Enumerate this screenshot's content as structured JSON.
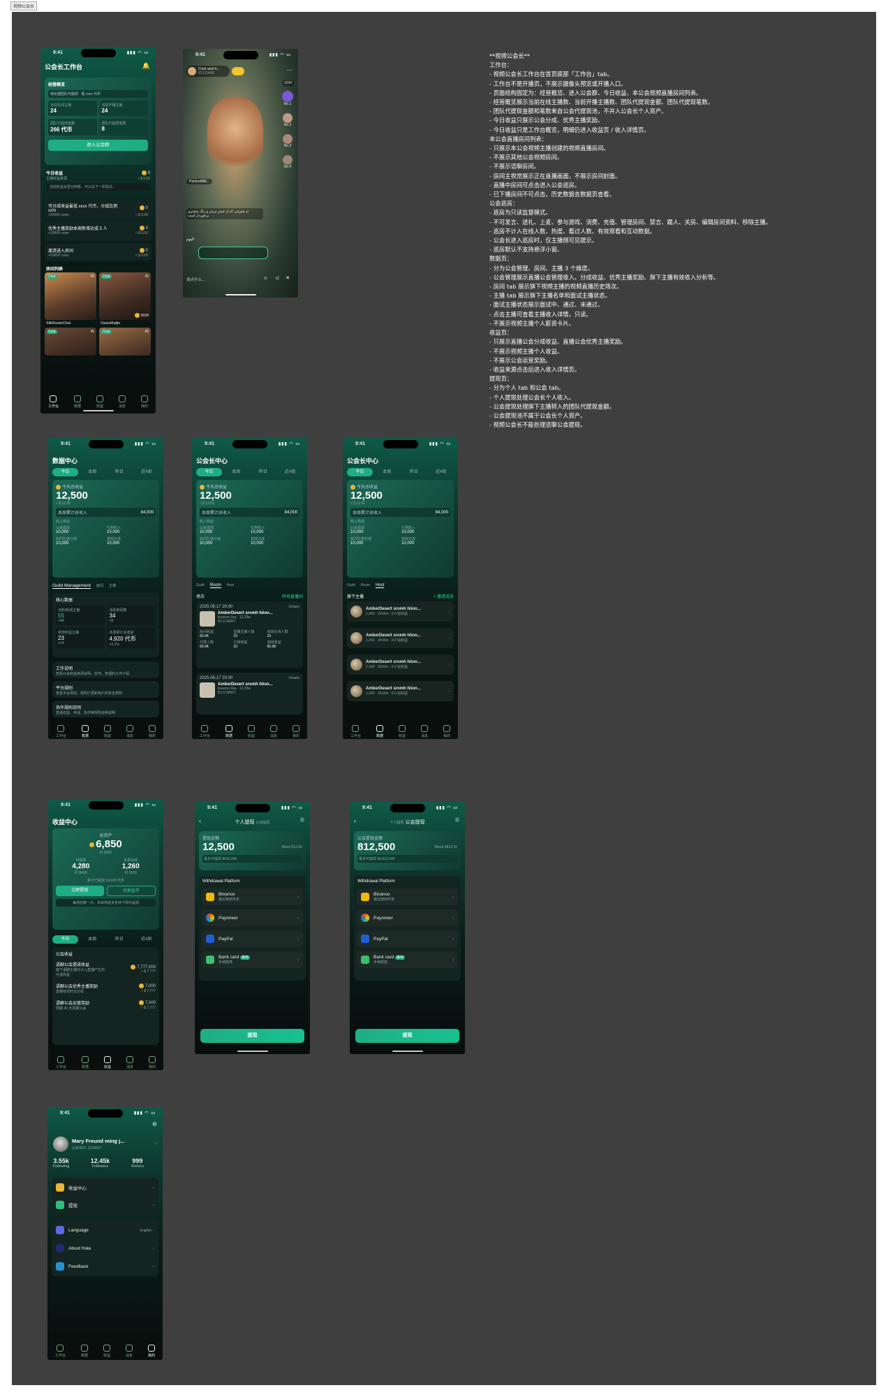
{
  "frame_tag": "视频公会长",
  "spec_text": "**视频公会长**\n工作台：\n- 视频公会长工作台在首页底部「工作台」tab。\n- 工作台不是开播页，不展示摄像头预览或开播入口。\n- 页面结构固定为：经营概览、进入公会群、今日收益、本公会视频直播房间列表。\n- 经营概览展示当前在线主播数、当前开播主播数、团队代提现金额、团队代提现笔数。\n- 团队代提现金额和笔数来自公会代提现池，不并入公会长个人资产。\n- 今日收益只展示公会分成、优秀主播奖励。\n- 今日收益只是工作台概览，明细仍进入收益页 / 收入详情页。\n本公会直播房间列表：\n- 只展示本公会视频主播创建的视频直播房间。\n- 不展示其他公会视频房间。\n- 不展示语聊房间。\n- 房间主视觉展示正在直播画面，不展示房间封面。\n- 直播中房间可点击进入公会巡房。\n- 已下播房间不可点击，历史数据去数据页查看。\n公会巡房：\n- 巡房为只读监督模式。\n- 不可发言、送礼、上麦、参与游戏、消费、充值、管理房间、禁言、踢人、关房、编辑房间资料、移除主播。\n- 巡房不计入在线人数、热度、看过人数、有效观看和互动数据。\n- 公会长进入巡房时，仅主播侧可见提示。\n- 巡房默认不支持悬浮小窗。\n数据页：\n- 分为公会管理、房间、主播 3 个维度。\n- 公会管理展示直播公会管理收入、分成收益、优秀主播奖励、旗下主播有效收入分析等。\n- 房间 tab 展示旗下视频主播的视频直播历史场次。\n- 主播 tab 展示旗下主播名单和面试主播状态。\n- 面试主播状态展示面试中、通过、未通过。\n- 点击主播可查看主播收入详情，只读。\n- 不展示视频主播个人薪资卡片。\n收益页：\n- 只展示直播公会分成收益、直播公会优秀主播奖励。\n- 不展示视频主播个人收益。\n- 不展示公会运营奖励。\n- 收益来源点击后进入收入详情页。\n提现页：\n- 分为个人 tab 和公会 tab。\n- 个人提现处理公会长个人收入。\n- 公会提现处理旗下主播转入的团队代提现金额。\n- 公会提现池不属于公会长个人资产。\n- 视频公会长不能处理语聊公会提现。",
  "status": {
    "time": "9:41",
    "signal": "▮▮▮ ◠ ▭"
  },
  "nav": [
    "工作台",
    "数据",
    "收益",
    "消息",
    "我的"
  ],
  "workbench": {
    "title": "公会长工作台",
    "overview_label": "经营概览",
    "overview_hint": "待处理团队代提现 · 笔 xxxx 代币",
    "stats": [
      {
        "label": "当前在线主播",
        "value": "24"
      },
      {
        "label": "当前开播主播",
        "value": "24"
      },
      {
        "label": "团队代提现金额",
        "value": "266 代币"
      },
      {
        "label": "团队代提现笔数",
        "value": "8"
      }
    ],
    "enter_group": "进入公会群",
    "today_label": "今日收益",
    "today_sub": "主播收益来源",
    "today_coin": "0",
    "today_usd": "≈ $ 0.00",
    "notice": "· 当前收益会登记到账，可以在下一阶段兑...",
    "tasks": [
      {
        "title": "可分成收益最低 xxxx 代币，分成比例 xx%",
        "reward": "+20000 coins",
        "coin": "0",
        "usd": "≈ $ 0.00"
      },
      {
        "title": "优秀主播奖励本周新增达成 5 人",
        "reward": "+20000 coins",
        "coin": "0",
        "usd": "≈ $ 0.00"
      },
      {
        "title": "邀请进入房间",
        "reward": "+20000 coins",
        "coin": "0",
        "usd": "≈ $ 0.00"
      }
    ],
    "rooms_label": "房间列表",
    "rooms": [
      {
        "tag": "Chat",
        "viewers": "45",
        "name": "SilkRouteChat",
        "coin": ""
      },
      {
        "tag": "Chat",
        "viewers": "45",
        "name": "OasisMajlis",
        "coin": "8038"
      },
      {
        "tag": "Chat",
        "viewers": "45",
        "name": "",
        "coin": ""
      },
      {
        "tag": "Chat",
        "viewers": "45",
        "name": "",
        "coin": ""
      }
    ]
  },
  "live": {
    "host": "Cool and h...",
    "host_id": "ID:123456",
    "viewers": "1234",
    "ranks": [
      "No.1",
      "No.2",
      "No.3",
      "No.4"
    ],
    "chat_user": "ParlorsMillt...",
    "chat_msgs": [
      "نه شیرایی که از خمیر نرمتر و رنگ بیشتری برخوردار است",
      "اليوم"
    ],
    "input_placeholder": "说点什么..."
  },
  "data": {
    "title": "数据中心",
    "subtitle": "公会长中心",
    "tabs": [
      "今日",
      "本周",
      "昨日",
      "近4周"
    ],
    "income_label": "今天总收益",
    "income_value": "12,500",
    "income_usd": "≈ $ 12.50",
    "week_label": "本周累计总收入",
    "week_value": "84,000",
    "parts_label": "收入构成",
    "parts": [
      {
        "label": "公会提成",
        "value": "10,000"
      },
      {
        "label": "礼物收入",
        "value": "10,000"
      },
      {
        "label": "房间礼物分成",
        "value": "10,000"
      },
      {
        "label": "游戏分成",
        "value": "10,000"
      }
    ],
    "sub_tabs": [
      "Guild Management",
      "房间",
      "主播"
    ],
    "sub_tabs_short": [
      "Guild",
      "Room",
      "Host"
    ],
    "core_label": "核心数据",
    "core": [
      {
        "label": "活跃/新增主播",
        "value": "55",
        "delta": "+48"
      },
      {
        "label": "活跃房间数",
        "value": "34",
        "delta": "+8"
      },
      {
        "label": "有效收益主播",
        "value": "23",
        "delta": "+14"
      },
      {
        "label": "本周累计总收益",
        "value": "4,920 代币",
        "delta": "+4.1%"
      }
    ],
    "links": [
      {
        "title": "工作说明",
        "desc": "查看公会收益来源说明，协作，管理的工作介绍"
      },
      {
        "title": "平台规则",
        "desc": "查看平台规则，规则已更新用户的安全规则"
      },
      {
        "title": "协作规则说明",
        "desc": "查看收益、申请、协作等规则说明说明"
      }
    ],
    "session_label": "场次",
    "session_filter": "所有直播间",
    "sessions": [
      {
        "date": "2025-05-17 20:00",
        "details": "Details",
        "name": "AmberDesert sromh hiion...",
        "dur": "2h16m",
        "user": "lisaxxxx lisa",
        "id": "ID:1234567",
        "hot": "12.23w",
        "metrics": [
          [
            "房间收益",
            "60.0K"
          ],
          [
            "直播主播人数",
            "23"
          ],
          [
            "有效在线人数",
            "23"
          ],
          [
            "付费人数",
            "60.0K"
          ],
          [
            "礼物收益",
            "23"
          ],
          [
            "游戏收益",
            "60.0K"
          ]
        ]
      },
      {
        "date": "2025-05-17 20:00",
        "details": "Details",
        "name": "AmberDesert sromh hiion...",
        "dur": "2h16m",
        "user": "lisaxxxx lisa",
        "id": "ID:1234567",
        "hot": "12.23w",
        "metrics": []
      }
    ],
    "hosts_label": "旗下主播",
    "hosts_invite": "+ 邀请成员",
    "hosts": [
      {
        "name": "AmberDesert sromh hiion...",
        "meta": "1,260 · 2h16m · 0.0 钻收益"
      },
      {
        "name": "AmberDesert sromh hiion...",
        "meta": "1,260 · 2h16m · 0.0 钻收益"
      },
      {
        "name": "AmberDesert sromh hiion...",
        "meta": "1,260 · 2h16m · 0.0 钻收益"
      },
      {
        "name": "AmberDesert sromh hiion...",
        "meta": "1,260 · 2h16m · 0.0 钻收益"
      }
    ]
  },
  "earnings": {
    "title": "收益中心",
    "asset_label": "总资产",
    "asset_value": "6,850",
    "asset_usd": "约 $685",
    "left_label": "可提现",
    "left_value": "4,280",
    "left_usd": "约 $428",
    "right_label": "本周冻结",
    "right_value": "1,260",
    "right_usd": "约 $126",
    "cum": "累计已提现 19,320 代币",
    "btn_withdraw": "立即提现",
    "btn_exchange": "兑换金币",
    "tip": "每周结算一次，未来将逐步支持下周代提现",
    "tabs": [
      "今日",
      "本周",
      "昨日",
      "近4周"
    ],
    "guild_label": "公会收益",
    "items": [
      {
        "title": "语聊公会提成收益",
        "desc": "旗下语聊主播日计入直播产生的分成收益",
        "coin": "7,777,000",
        "usd": "≈ $ 7,777"
      },
      {
        "title": "语聊公会优秀主播奖励",
        "desc": "直播有效时长达标",
        "coin": "7,000",
        "usd": "≈ $ 7,777"
      },
      {
        "title": "语聊公会运营奖励",
        "desc": "周期 30 天周期公会",
        "coin": "7,000",
        "usd": "≈ $ 7,777"
      }
    ]
  },
  "withdraw_personal": {
    "tab_a": "个人提现",
    "tab_b": "公会提现",
    "label": "提现金额",
    "value": "12,500",
    "about": "About $12.50",
    "min": "最多可提现 $835,000",
    "platform_label": "Withdrawal Platform",
    "platforms": [
      {
        "name": "Binance",
        "sub": "建议使用币安"
      },
      {
        "name": "Payoneer",
        "sub": ""
      },
      {
        "name": "PayPal",
        "sub": ""
      },
      {
        "name": "Bank card",
        "sub": "手续费高",
        "badge": "推荐"
      }
    ],
    "submit": "提现"
  },
  "withdraw_guild": {
    "label": "公会提现金额",
    "value": "812,500",
    "about": "About $812.50",
    "min": "最多可提现 $8,812,500"
  },
  "profile": {
    "name": "Mary Freund ming j...",
    "id": "公会长ID: 1234567",
    "stats": [
      {
        "value": "3.55k",
        "label": "Following"
      },
      {
        "value": "12.45k",
        "label": "Followers"
      },
      {
        "value": "999",
        "label": "Visitors"
      }
    ],
    "menu_a": [
      {
        "label": "收益中心",
        "extra": ""
      },
      {
        "label": "提现",
        "extra": ""
      }
    ],
    "menu_b": [
      {
        "label": "Language",
        "extra": "English"
      },
      {
        "label": "About Hala",
        "extra": ""
      },
      {
        "label": "Feedback",
        "extra": ""
      }
    ]
  }
}
